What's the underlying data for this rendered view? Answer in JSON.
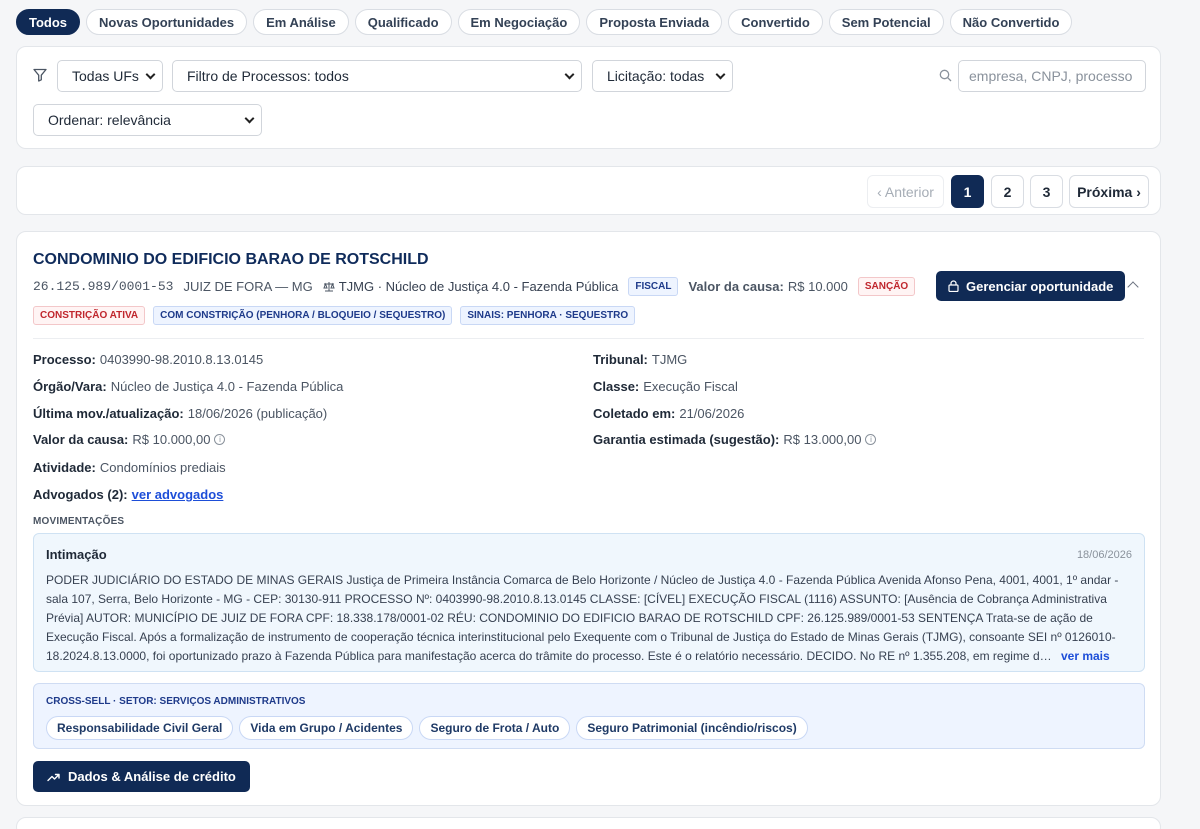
{
  "tabs": [
    {
      "label": "Todos",
      "active": true
    },
    {
      "label": "Novas Oportunidades"
    },
    {
      "label": "Em Análise"
    },
    {
      "label": "Qualificado"
    },
    {
      "label": "Em Negociação"
    },
    {
      "label": "Proposta Enviada"
    },
    {
      "label": "Convertido"
    },
    {
      "label": "Sem Potencial"
    },
    {
      "label": "Não Convertido"
    }
  ],
  "filters": {
    "uf": "Todas UFs",
    "processos": "Filtro de Processos: todos",
    "licitacao": "Licitação: todas",
    "ordenar": "Ordenar: relevância",
    "search_placeholder": "empresa, CNPJ, processo"
  },
  "pagination": {
    "prev": "‹ Anterior",
    "pages": [
      "1",
      "2",
      "3"
    ],
    "current": "1",
    "next": "Próxima ›"
  },
  "company": {
    "name": "CONDOMINIO DO EDIFICIO BARAO DE ROTSCHILD",
    "cnpj": "26.125.989/0001-53",
    "city": "JUIZ DE FORA — MG",
    "court": "TJMG · Núcleo de Justiça 4.0 - Fazenda Pública",
    "badge_fiscal": "FISCAL",
    "valor_label": "Valor da causa:",
    "valor": "R$ 10.000",
    "badge_sancao": "SANÇÃO",
    "badges": [
      "CONSTRIÇÃO ATIVA",
      "COM CONSTRIÇÃO (PENHORA / BLOQUEIO / SEQUESTRO)",
      "SINAIS: PENHORA · SEQUESTRO"
    ],
    "manage_button": "Gerenciar oportunidade"
  },
  "details": {
    "processo": {
      "label": "Processo:",
      "value": "0403990-98.2010.8.13.0145"
    },
    "orgao": {
      "label": "Órgão/Vara:",
      "value": "Núcleo de Justiça 4.0 - Fazenda Pública"
    },
    "ultima": {
      "label": "Última mov./atualização:",
      "value": "18/06/2026 (publicação)"
    },
    "valor": {
      "label": "Valor da causa:",
      "value": "R$ 10.000,00"
    },
    "atividade": {
      "label": "Atividade:",
      "value": "Condomínios prediais"
    },
    "advogados": {
      "label": "Advogados (2):",
      "value": "ver advogados"
    },
    "tribunal": {
      "label": "Tribunal:",
      "value": "TJMG"
    },
    "classe": {
      "label": "Classe:",
      "value": "Execução Fiscal"
    },
    "coletado": {
      "label": "Coletado em:",
      "value": "21/06/2026"
    },
    "garantia": {
      "label": "Garantia estimada (sugestão):",
      "value": "R$ 13.000,00"
    }
  },
  "movimentacoes": {
    "label": "MOVIMENTAÇÕES",
    "title": "Intimação",
    "date": "18/06/2026",
    "text": "PODER JUDICIÁRIO DO ESTADO DE MINAS GERAIS Justiça de Primeira Instância Comarca de Belo Horizonte / Núcleo de Justiça 4.0 - Fazenda Pública Avenida Afonso Pena, 4001, 4001, 1º andar - sala 107, Serra, Belo Horizonte - MG - CEP: 30130-911 PROCESSO Nº: 0403990-98.2010.8.13.0145 CLASSE: [CÍVEL] EXECUÇÃO FISCAL (1116) ASSUNTO: [Ausência de Cobrança Administrativa Prévia] AUTOR: MUNICÍPIO DE JUIZ DE FORA CPF: 18.338.178/0001-02 RÉU: CONDOMINIO DO EDIFICIO BARAO DE ROTSCHILD CPF: 26.125.989/0001-53 SENTENÇA Trata-se de ação de Execução Fiscal. Após a formalização de instrumento de cooperação técnica interinstitucional pelo Exequente com o Tribunal de Justiça do Estado de Minas Gerais (TJMG), consoante SEI nº 0126010-18.2024.8.13.0000, foi oportunizado prazo à Fazenda Pública para manifestação acerca do trâmite do processo. Este é o relatório necessário. DECIDO. No RE nº 1.355.208, em regime d…",
    "more": "ver mais"
  },
  "cross_sell": {
    "label": "CROSS-SELL · SETOR: SERVIÇOS ADMINISTRATIVOS",
    "chips": [
      "Responsabilidade Civil Geral",
      "Vida em Grupo / Acidentes",
      "Seguro de Frota / Auto",
      "Seguro Patrimonial (incêndio/riscos)"
    ]
  },
  "credit_button": "Dados & Análise de crédito"
}
